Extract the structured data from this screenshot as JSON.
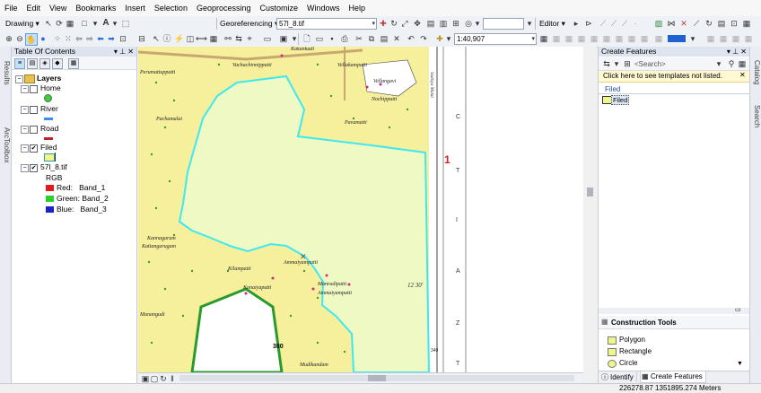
{
  "menu": [
    "File",
    "Edit",
    "View",
    "Bookmarks",
    "Insert",
    "Selection",
    "Geoprocessing",
    "Customize",
    "Windows",
    "Help"
  ],
  "toolbar": {
    "drawing_label": "Drawing",
    "text_tool": "A",
    "georeferencing_label": "Georeferencing",
    "layer_combo": "57l_8.tif",
    "editor_label": "Editor",
    "scale_value": "1:40,907"
  },
  "left_tabs": [
    "Results",
    "ArcToolbox"
  ],
  "right_tabs": [
    "Catalog",
    "Search"
  ],
  "toc": {
    "title": "Table Of Contents",
    "root": "Layers",
    "layers": [
      {
        "name": "Home",
        "checked": false,
        "swatch": "#4cc24c",
        "swatch_type": "circle"
      },
      {
        "name": "River",
        "checked": false,
        "swatch": "#3a8bff",
        "swatch_type": "line"
      },
      {
        "name": "Road",
        "checked": false,
        "swatch": "#c0202a",
        "swatch_type": "line"
      },
      {
        "name": "Filed",
        "checked": true,
        "swatch": "#eef58a",
        "swatch_type": "rect"
      },
      {
        "name": "57l_8.tif",
        "checked": true,
        "swatch": "",
        "swatch_type": "none"
      }
    ],
    "raster_header": "RGB",
    "bands": [
      {
        "label": "Red:",
        "band": "Band_1",
        "color": "#e31a1c"
      },
      {
        "label": "Green:",
        "band": "Band_2",
        "color": "#2cd02c"
      },
      {
        "label": "Blue:",
        "band": "Band_3",
        "color": "#1a22c8"
      }
    ]
  },
  "map": {
    "place_labels": [
      "Perumattuppatti",
      "Vachachinnippatti",
      "Kakankadi",
      "Vellakampatti",
      "Vellangavi",
      "Nochippatti",
      "Pavamatti",
      "Pachamalai",
      "Kannagaram",
      "Kattangarugam",
      "Kilampatti",
      "Ammaiyampatti",
      "Konaiyapatti",
      "Manradipatti",
      "Ammaiyampatti",
      "Manangudi",
      "Mudikandam"
    ],
    "ridge_label": "Sadisya Malai",
    "grid_label_red": "1",
    "margin_letters": [
      "C",
      "T",
      "I",
      "A",
      "Z",
      "T"
    ],
    "margin_coord": "12 30'",
    "spot_height": "380",
    "contour_value": "340",
    "colors": {
      "parcel_fill": "#eef9c4",
      "parcel_border": "#3ee8f0",
      "forest": "#f6ef9c",
      "green_area": "#ffffff"
    }
  },
  "create_features": {
    "title": "Create Features",
    "search_placeholder": "<Search>",
    "info_message": "Click here to see templates not listed.",
    "group": "Filed",
    "template": "Filed"
  },
  "construction_tools": {
    "title": "Construction Tools",
    "tools": [
      {
        "label": "Polygon"
      },
      {
        "label": "Rectangle"
      },
      {
        "label": "Circle"
      }
    ]
  },
  "bottom_tabs": [
    "Identify",
    "Create Features"
  ],
  "status": {
    "coords": "226278.87  1351895.274 Meters"
  }
}
